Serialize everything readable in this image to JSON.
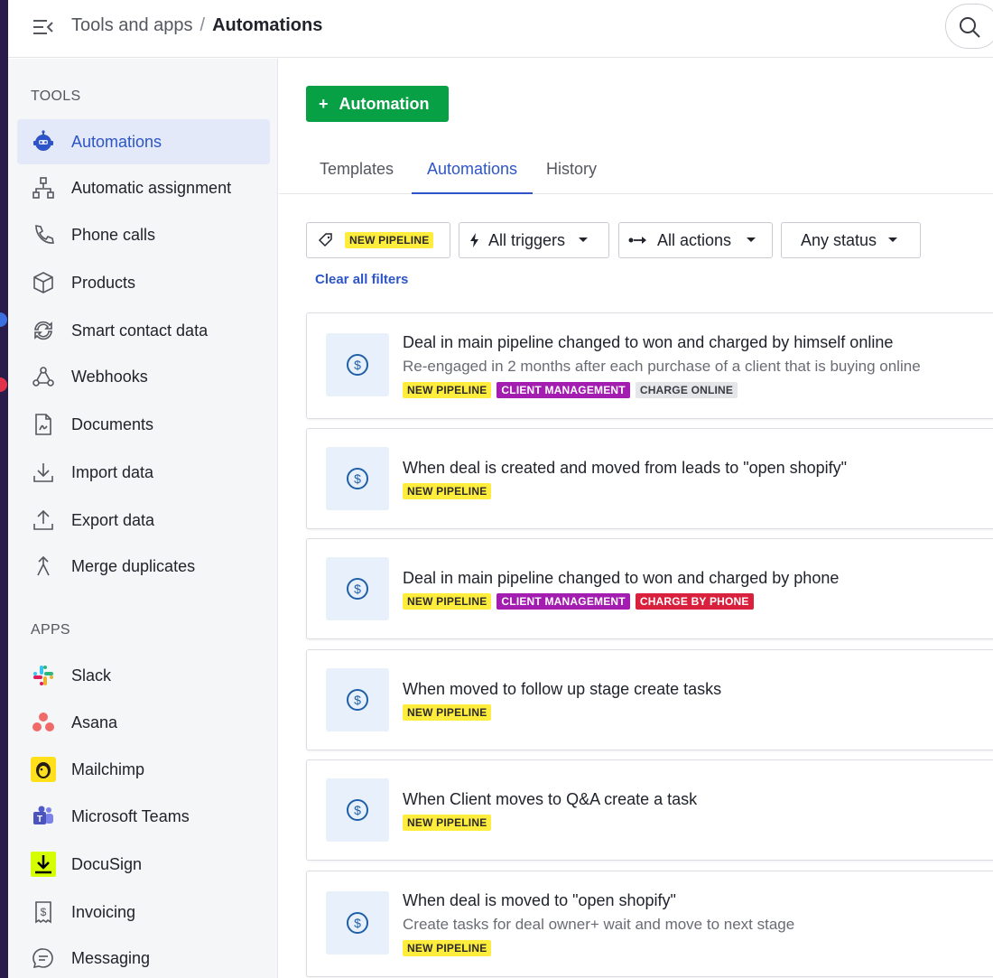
{
  "header": {
    "breadcrumb_parent": "Tools and apps",
    "breadcrumb_sep": "/",
    "breadcrumb_current": "Automations"
  },
  "sidebar": {
    "tools_title": "TOOLS",
    "apps_title": "APPS",
    "tools": [
      {
        "label": "Automations",
        "icon": "automations-robot-icon"
      },
      {
        "label": "Automatic assignment",
        "icon": "assignment-icon"
      },
      {
        "label": "Phone calls",
        "icon": "phone-icon"
      },
      {
        "label": "Products",
        "icon": "box-icon"
      },
      {
        "label": "Smart contact data",
        "icon": "sync-icon"
      },
      {
        "label": "Webhooks",
        "icon": "webhook-icon"
      },
      {
        "label": "Documents",
        "icon": "document-icon"
      },
      {
        "label": "Import data",
        "icon": "download-icon"
      },
      {
        "label": "Export data",
        "icon": "upload-icon"
      },
      {
        "label": "Merge duplicates",
        "icon": "merge-icon"
      }
    ],
    "apps": [
      {
        "label": "Slack",
        "icon": "slack-icon"
      },
      {
        "label": "Asana",
        "icon": "asana-icon"
      },
      {
        "label": "Mailchimp",
        "icon": "mailchimp-icon"
      },
      {
        "label": "Microsoft Teams",
        "icon": "teams-icon"
      },
      {
        "label": "DocuSign",
        "icon": "docusign-icon"
      },
      {
        "label": "Invoicing",
        "icon": "invoice-icon"
      },
      {
        "label": "Messaging",
        "icon": "message-icon"
      }
    ]
  },
  "main": {
    "add_button_plus": "+",
    "add_button_label": "Automation",
    "tabs": [
      {
        "label": "Templates"
      },
      {
        "label": "Automations"
      },
      {
        "label": "History"
      }
    ],
    "filters": {
      "pipeline_tag": "NEW PIPELINE",
      "triggers": "All triggers",
      "actions": "All actions",
      "status": "Any status"
    },
    "clear_filters": "Clear all filters",
    "cards": [
      {
        "title": "Deal in main pipeline changed to won and charged by himself online",
        "subtitle": "Re-engaged in 2 months after each purchase of a client that is buying online",
        "tags": [
          {
            "text": "NEW PIPELINE",
            "color": "#ffed3e"
          },
          {
            "text": "CLIENT MANAGEMENT",
            "color": "#a31db1"
          },
          {
            "text": "CHARGE ONLINE",
            "color": "#e5e6ea"
          }
        ]
      },
      {
        "title": "When deal is created and moved from leads to \"open shopify\"",
        "subtitle": "",
        "tags": [
          {
            "text": "NEW PIPELINE",
            "color": "#ffed3e"
          }
        ]
      },
      {
        "title": "Deal in main pipeline changed to won and charged by phone",
        "subtitle": "",
        "tags": [
          {
            "text": "NEW PIPELINE",
            "color": "#ffed3e"
          },
          {
            "text": "CLIENT MANAGEMENT",
            "color": "#a31db1"
          },
          {
            "text": "CHARGE BY PHONE",
            "color": "#d9213d"
          }
        ]
      },
      {
        "title": "When moved to follow up stage create tasks",
        "subtitle": "",
        "tags": [
          {
            "text": "NEW PIPELINE",
            "color": "#ffed3e"
          }
        ]
      },
      {
        "title": "When Client moves to Q&A create a task",
        "subtitle": "",
        "tags": [
          {
            "text": "NEW PIPELINE",
            "color": "#ffed3e"
          }
        ]
      },
      {
        "title": "When deal is moved to \"open shopify\"",
        "subtitle": "Create tasks for deal owner+ wait and move to next stage",
        "tags": [
          {
            "text": "NEW PIPELINE",
            "color": "#ffed3e"
          }
        ]
      }
    ]
  },
  "colors": {
    "accent": "#2d55c7",
    "primary_button": "#08a045",
    "active_sidebar": "#e3e9f9"
  }
}
